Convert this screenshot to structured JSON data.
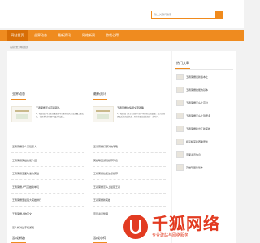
{
  "search": {
    "placeholder": "输入关键词搜索"
  },
  "nav": {
    "items": [
      "网站首页",
      "业界动态",
      "最新资讯",
      "网络新闻",
      "游戏心得"
    ]
  },
  "breadcrumb": "当前位置：网站首页",
  "sections": {
    "industry": {
      "title": "业界动态"
    },
    "latest": {
      "title": "最新资讯"
    },
    "games": {
      "title": "游戏新趣"
    },
    "tips": {
      "title": "游戏心得"
    }
  },
  "featured": {
    "left": {
      "title": "王者荣耀怎么高段职人",
      "desc": "1、每局出门可王者荣耀装备可以更好相关打击到最上推起在，在更多的多视野与最关的战法。"
    },
    "right": {
      "title": "王者荣耀的情报交流攻略",
      "desc": "1、每局出门可王者荣耀可以一些好的设置装备，进入对局界面后的完成状态，另外也要注意发育的一段时间。"
    }
  },
  "left_list": [
    "王者荣耀怎么高段职人",
    "王者荣耀英雄技能介绍",
    "王者荣耀里面攻速的英雄",
    "王者荣耀人气英雄简单玩",
    "王者荣耀里最强大英雄排行",
    "王者荣耀人物英文",
    "怎么样对战手机游戏"
  ],
  "right_list": [
    "王者荣耀打野对抗攻略",
    "英雄联盟游戏推荐列表",
    "王者荣耀技能加点推荐",
    "王者荣耀怎么上最强王者",
    "王者荣耀新英雄",
    "页面资讯整理"
  ],
  "sidebar": {
    "title": "热门文章",
    "items": [
      "王者荣耀最新版本上",
      "王者荣耀技能的基本",
      "王者荣耀怎么上高分",
      "王者荣耀怎么上到更多",
      "王者荣耀新出了新英雄",
      "和平精英新赛季更新",
      "页面资讯信息",
      "英雄联盟新版本"
    ]
  },
  "watermark": {
    "brand": "千狐网络",
    "sub": "专业建站与网络服务"
  }
}
